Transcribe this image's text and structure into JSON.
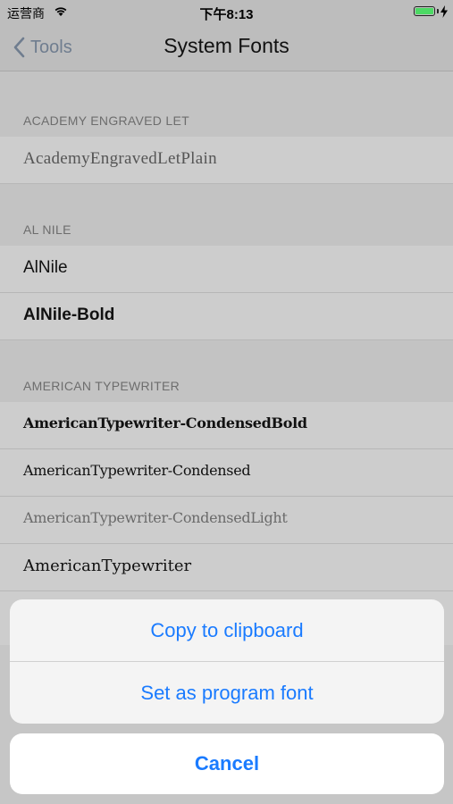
{
  "status_bar": {
    "carrier": "运营商",
    "time": "下午8:13",
    "battery_level": 1.0,
    "battery_color": "#4cd964"
  },
  "nav": {
    "back_label": "Tools",
    "title": "System Fonts"
  },
  "sections": [
    {
      "header": "ACADEMY ENGRAVED LET",
      "fonts": [
        "AcademyEngravedLetPlain"
      ]
    },
    {
      "header": "AL NILE",
      "fonts": [
        "AlNile",
        "AlNile-Bold"
      ]
    },
    {
      "header": "AMERICAN TYPEWRITER",
      "fonts": [
        "AmericanTypewriter-CondensedBold",
        "AmericanTypewriter-Condensed",
        "AmericanTypewriter-CondensedLight",
        "AmericanTypewriter"
      ]
    }
  ],
  "action_sheet": {
    "copy_label": "Copy to clipboard",
    "set_font_label": "Set as program font",
    "cancel_label": "Cancel"
  },
  "colors": {
    "accent": "#1a7bff",
    "back_tint": "#6f7d8f"
  }
}
